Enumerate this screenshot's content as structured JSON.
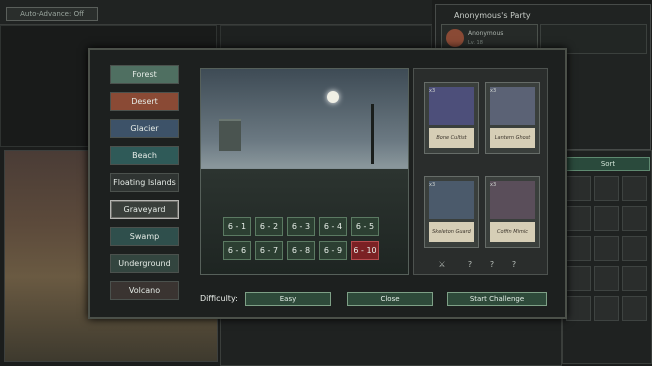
{
  "top_bar": {
    "auto_advance_label": "Auto-Advance: Off"
  },
  "party": {
    "title": "Anonymous's Party",
    "member_name": "Anonymous",
    "member_level": "Lv. 18"
  },
  "inventory": {
    "sort_label": "Sort"
  },
  "dialog": {
    "biomes": [
      {
        "label": "Forest",
        "color": "#4f6f61"
      },
      {
        "label": "Desert",
        "color": "#8a4a35"
      },
      {
        "label": "Glacier",
        "color": "#3d5268"
      },
      {
        "label": "Beach",
        "color": "#2f5a58"
      },
      {
        "label": "Floating Islands",
        "color": "#2f3432"
      },
      {
        "label": "Graveyard",
        "color": "#3a3f3b",
        "selected": true
      },
      {
        "label": "Swamp",
        "color": "#2f4f4c"
      },
      {
        "label": "Underground",
        "color": "#33453f"
      },
      {
        "label": "Volcano",
        "color": "#3a3431"
      }
    ],
    "levels": [
      "6 - 1",
      "6 - 2",
      "6 - 3",
      "6 - 4",
      "6 - 5",
      "6 - 6",
      "6 - 7",
      "6 - 8",
      "6 - 9",
      "6 - 10"
    ],
    "enemies": [
      {
        "name": "Bone Cultist",
        "count": "x3"
      },
      {
        "name": "Lantern Ghost",
        "count": "x3"
      },
      {
        "name": "Skeleton Guard",
        "count": "x3"
      },
      {
        "name": "Coffin Mimic",
        "count": "x3"
      }
    ],
    "drops": [
      "⚔",
      "?",
      "?",
      "?"
    ],
    "difficulty_label": "Difficulty:",
    "difficulty_value": "Easy",
    "close_label": "Close",
    "start_label": "Start Challenge"
  }
}
